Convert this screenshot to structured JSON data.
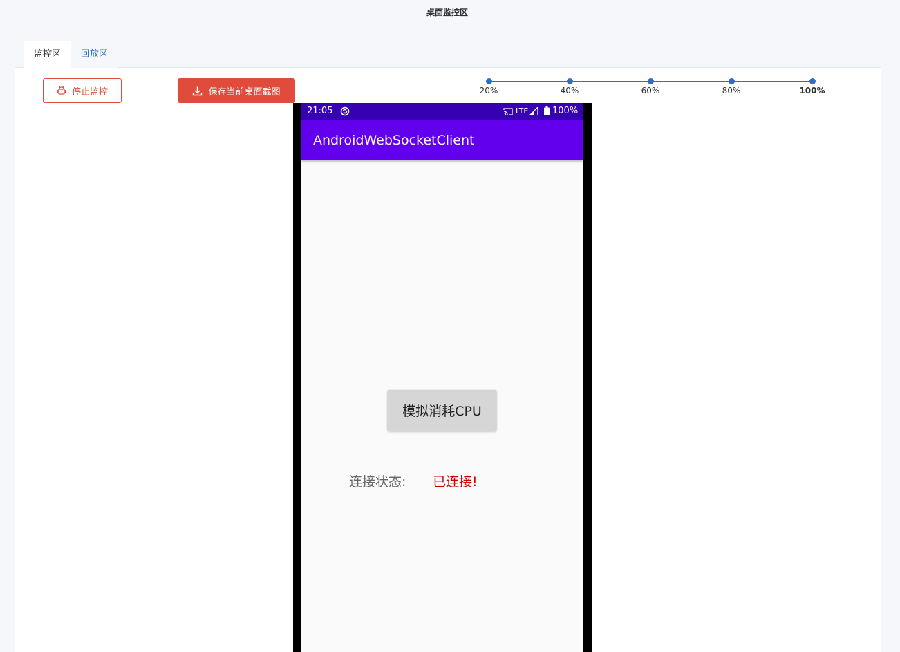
{
  "section": {
    "title": "桌面监控区"
  },
  "tabs": [
    {
      "label": "监控区",
      "active": true
    },
    {
      "label": "回放区",
      "active": false
    }
  ],
  "toolbar": {
    "stop_label": "停止监控",
    "save_label": "保存当前桌面截图"
  },
  "slider": {
    "marks": [
      "20%",
      "40%",
      "60%",
      "80%",
      "100%"
    ],
    "selected": "100%"
  },
  "phone": {
    "time": "21:05",
    "network": "LTE",
    "battery": "100%",
    "app_title": "AndroidWebSocketClient",
    "cpu_button": "模拟消耗CPU",
    "status_label": "连接状态:",
    "status_value": "已连接!"
  },
  "colors": {
    "danger": "#e04b3c",
    "primary": "#2a6fc5",
    "app_bar": "#6200ee",
    "status_bar": "#3700b3",
    "connected": "#d00000"
  }
}
